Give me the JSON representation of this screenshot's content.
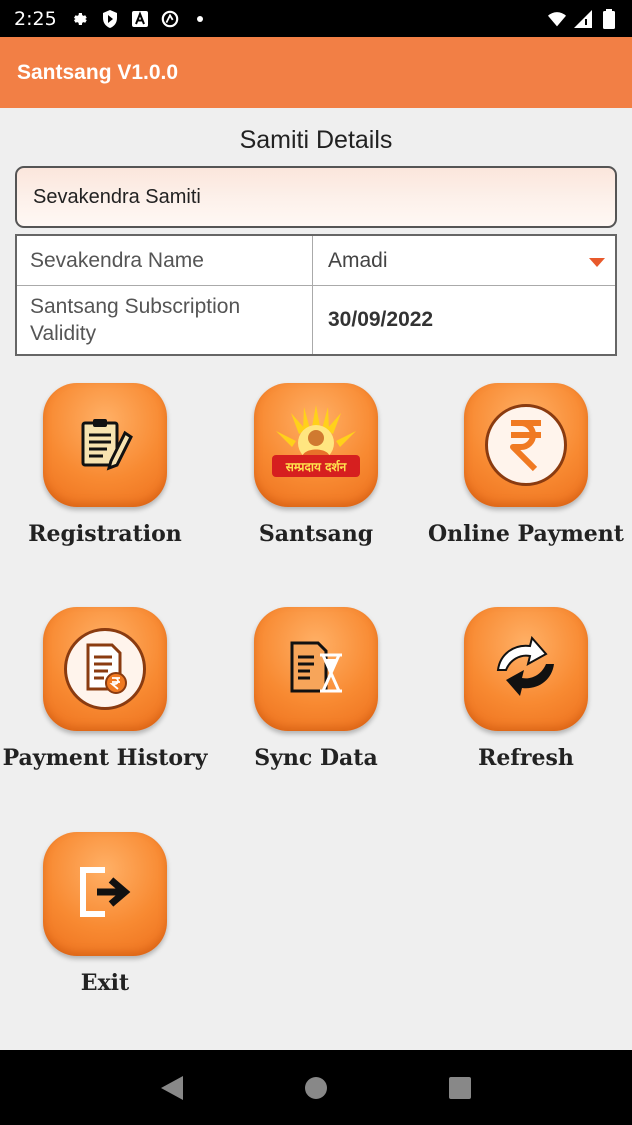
{
  "status_bar": {
    "time": "2:25",
    "left_icons": [
      "gear-icon",
      "shield-icon",
      "a-icon",
      "at-icon",
      "dot-icon"
    ],
    "right_icons": [
      "wifi-icon",
      "signal-icon",
      "battery-icon"
    ]
  },
  "app_bar": {
    "title": "Santsang V1.0.0"
  },
  "section_title": "Samiti Details",
  "samiti_field": {
    "value": "Sevakendra Samiti"
  },
  "info_table": {
    "rows": [
      {
        "label": "Sevakendra Name",
        "value": "Amadi"
      },
      {
        "label": "Santsang Subscription Validity",
        "value": "30/09/2022"
      }
    ]
  },
  "tiles": [
    {
      "label": "Registration",
      "icon": "clipboard-pen-icon"
    },
    {
      "label": "Santsang",
      "icon": "santsang-logo",
      "logo_text": "सम्प्रदाय दर्शन"
    },
    {
      "label": "Online Payment",
      "icon": "rupee-icon"
    },
    {
      "label": "Payment History",
      "icon": "payment-history-icon"
    },
    {
      "label": "Sync Data",
      "icon": "sync-data-icon"
    },
    {
      "label": "Refresh",
      "icon": "refresh-icon"
    },
    {
      "label": "Exit",
      "icon": "exit-icon"
    }
  ],
  "colors": {
    "app_bar": "#f27f45",
    "tile_orange": "#f88a32",
    "caret": "#e8592b",
    "background": "#efefef"
  },
  "nav_bar": {
    "buttons": [
      "back-icon",
      "home-icon",
      "recents-icon"
    ]
  }
}
